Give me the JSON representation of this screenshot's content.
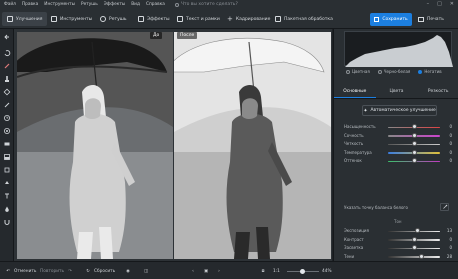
{
  "menu": {
    "items": [
      "Файл",
      "Правка",
      "Инструменты",
      "Ретушь",
      "Эффекты",
      "Вид",
      "Справка"
    ],
    "search_placeholder": "Что вы хотите сделать?"
  },
  "toolbar": {
    "tabs": [
      "Улучшения",
      "Инструменты",
      "Ретушь",
      "Эффекты",
      "Текст и рамки",
      "Кадрирование",
      "Пакетная обработка"
    ],
    "save_label": "Сохранить",
    "print_label": "Печать"
  },
  "compare": {
    "before_label": "До",
    "after_label": "После"
  },
  "panel": {
    "radios": [
      "Цветная",
      "Черно-белая",
      "Негатив"
    ],
    "selected_radio": "Негатив",
    "subtabs": [
      "Основные",
      "Цвета",
      "Резкость"
    ],
    "auto_button": "Автоматическое улучшение",
    "sliders_top": [
      {
        "label": "Насыщенность",
        "value": "0",
        "pos": 0.5,
        "gradient": "linear-gradient(90deg,#888,#d44)"
      },
      {
        "label": "Сочность",
        "value": "0",
        "pos": 0.5,
        "gradient": "linear-gradient(90deg,#888,#c4c)"
      },
      {
        "label": "Четкость",
        "value": "0",
        "pos": 0.5,
        "gradient": "linear-gradient(90deg,#555,#ccc)"
      },
      {
        "label": "Температура",
        "value": "0",
        "pos": 0.5,
        "gradient": "linear-gradient(90deg,#3a7de0,#e0c03a)"
      },
      {
        "label": "Оттенок",
        "value": "0",
        "pos": 0.5,
        "gradient": "linear-gradient(90deg,#3ac06a,#c03ac0)"
      }
    ],
    "wb_label": "Указать точку баланса белого",
    "tone_label": "Тон",
    "sliders_bottom": [
      {
        "label": "Экспозиция",
        "value": "13",
        "pos": 0.56,
        "gradient": "linear-gradient(90deg,#333,#eee)"
      },
      {
        "label": "Контраст",
        "value": "0",
        "pos": 0.5,
        "gradient": "linear-gradient(90deg,#333,#eee)"
      },
      {
        "label": "Засветка",
        "value": "0",
        "pos": 0.5,
        "gradient": "linear-gradient(90deg,#333,#eee)"
      },
      {
        "label": "Тени",
        "value": "28",
        "pos": 0.64,
        "gradient": "linear-gradient(90deg,#333,#eee)"
      },
      {
        "label": "Светлые",
        "value": "26",
        "pos": 0.63,
        "gradient": "linear-gradient(90deg,#333,#eee)"
      },
      {
        "label": "Темные",
        "value": "0",
        "pos": 0.5,
        "gradient": "linear-gradient(90deg,#333,#eee)"
      }
    ]
  },
  "bottom": {
    "undo_label": "Отменить",
    "redo_label": "Повторить",
    "reset_label": "Сбросить",
    "ratio_label": "1:1",
    "zoom_value": "44%"
  },
  "colors": {
    "accent": "#1c7fe0",
    "bg": "#1e2226",
    "panel": "#2a2f33"
  }
}
